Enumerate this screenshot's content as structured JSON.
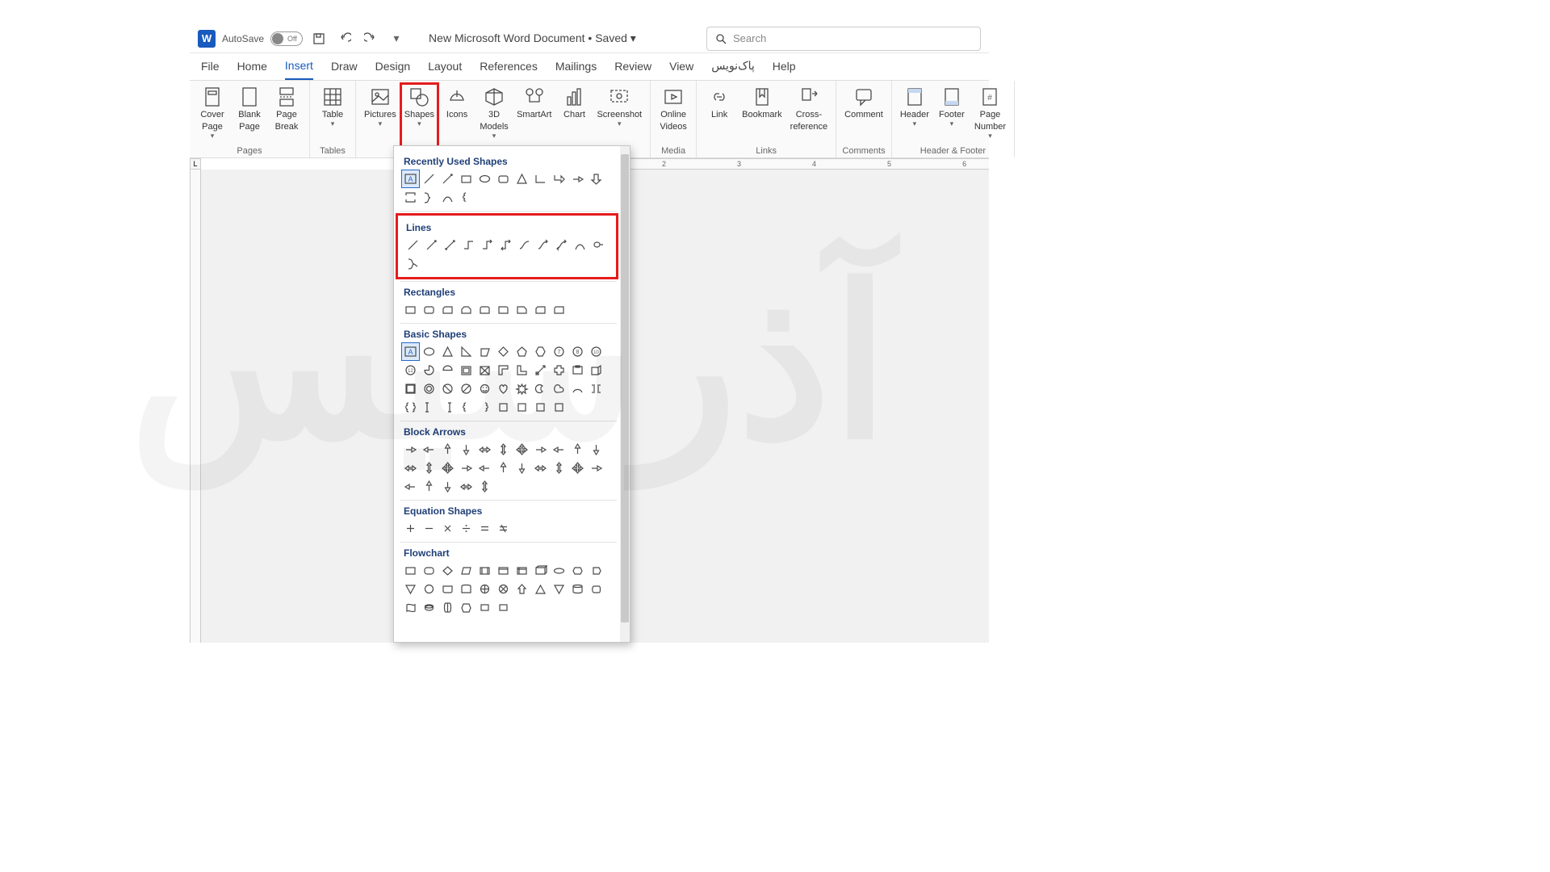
{
  "title_bar": {
    "autosave_label": "AutoSave",
    "autosave_state": "Off",
    "doc_title": "New Microsoft Word Document",
    "saved_state": "Saved",
    "search_placeholder": "Search"
  },
  "tabs": [
    "File",
    "Home",
    "Insert",
    "Draw",
    "Design",
    "Layout",
    "References",
    "Mailings",
    "Review",
    "View",
    "پاک‌نویس",
    "Help"
  ],
  "active_tab": "Insert",
  "ribbon": {
    "groups": [
      {
        "label": "Pages",
        "items": [
          {
            "id": "cover-page",
            "label": "Cover\nPage",
            "caret": true
          },
          {
            "id": "blank-page",
            "label": "Blank\nPage"
          },
          {
            "id": "page-break",
            "label": "Page\nBreak"
          }
        ]
      },
      {
        "label": "Tables",
        "items": [
          {
            "id": "table",
            "label": "Table",
            "caret": true
          }
        ]
      },
      {
        "label": "",
        "items": [
          {
            "id": "pictures",
            "label": "Pictures",
            "caret": true
          },
          {
            "id": "shapes",
            "label": "Shapes",
            "caret": true,
            "highlighted": true
          },
          {
            "id": "icons",
            "label": "Icons"
          },
          {
            "id": "3d-models",
            "label": "3D\nModels",
            "caret": true
          },
          {
            "id": "smartart",
            "label": "SmartArt"
          },
          {
            "id": "chart",
            "label": "Chart"
          },
          {
            "id": "screenshot",
            "label": "Screenshot",
            "caret": true
          }
        ]
      },
      {
        "label": "Media",
        "items": [
          {
            "id": "online-videos",
            "label": "Online\nVideos"
          }
        ]
      },
      {
        "label": "Links",
        "items": [
          {
            "id": "link",
            "label": "Link"
          },
          {
            "id": "bookmark",
            "label": "Bookmark"
          },
          {
            "id": "cross-reference",
            "label": "Cross-\nreference"
          }
        ]
      },
      {
        "label": "Comments",
        "items": [
          {
            "id": "comment",
            "label": "Comment"
          }
        ]
      },
      {
        "label": "Header & Footer",
        "items": [
          {
            "id": "header",
            "label": "Header",
            "caret": true
          },
          {
            "id": "footer",
            "label": "Footer",
            "caret": true
          },
          {
            "id": "page-number",
            "label": "Page\nNumber",
            "caret": true
          }
        ]
      }
    ]
  },
  "ruler_h_ticks": [
    "2",
    "3",
    "4",
    "5",
    "6"
  ],
  "shapes_panel": {
    "sections": [
      {
        "id": "recent",
        "title": "Recently Used Shapes",
        "count": 15
      },
      {
        "id": "lines",
        "title": "Lines",
        "count": 12,
        "highlighted": true
      },
      {
        "id": "rectangles",
        "title": "Rectangles",
        "count": 9
      },
      {
        "id": "basic",
        "title": "Basic Shapes",
        "count": 42
      },
      {
        "id": "arrows",
        "title": "Block Arrows",
        "count": 27
      },
      {
        "id": "equation",
        "title": "Equation Shapes",
        "count": 6
      },
      {
        "id": "flowchart",
        "title": "Flowchart",
        "count": 28
      }
    ]
  }
}
